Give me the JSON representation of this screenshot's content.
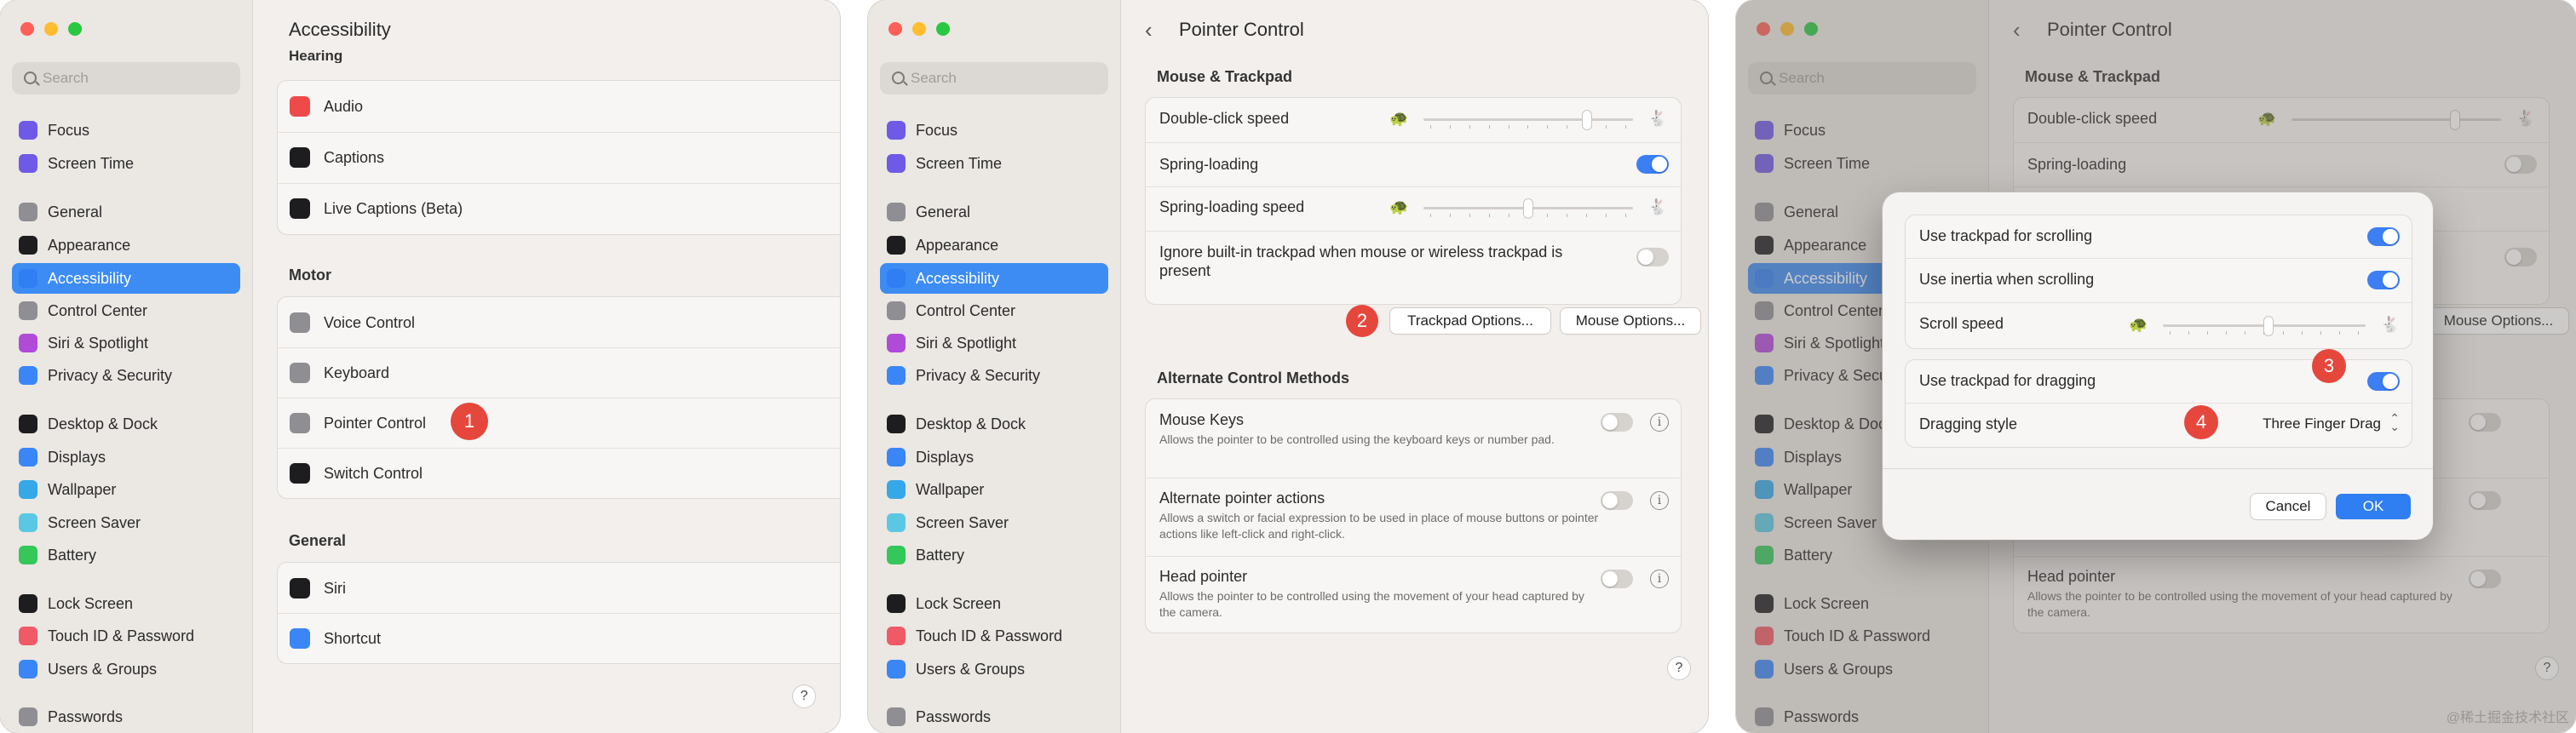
{
  "panels": [
    {
      "sidebar": {
        "search_placeholder": "Search",
        "items": [
          {
            "label": "Focus",
            "icon": "moon-icon",
            "color": "#6e5ae6"
          },
          {
            "label": "Screen Time",
            "icon": "hourglass-icon",
            "color": "#6e5ae6"
          },
          {
            "label": "General",
            "icon": "gear-icon",
            "color": "#8e8e93"
          },
          {
            "label": "Appearance",
            "icon": "appearance-icon",
            "color": "#1d1d1f"
          },
          {
            "label": "Accessibility",
            "icon": "accessibility-icon",
            "color": "#2f7ef2",
            "active": true
          },
          {
            "label": "Control Center",
            "icon": "control-center-icon",
            "color": "#8e8e93"
          },
          {
            "label": "Siri & Spotlight",
            "icon": "siri-icon",
            "color": "#b04ad9"
          },
          {
            "label": "Privacy & Security",
            "icon": "hand-icon",
            "color": "#3a86f6"
          },
          {
            "label": "Desktop & Dock",
            "icon": "dock-icon",
            "color": "#1d1d1f"
          },
          {
            "label": "Displays",
            "icon": "display-icon",
            "color": "#3a86f6"
          },
          {
            "label": "Wallpaper",
            "icon": "wallpaper-icon",
            "color": "#35a8e8"
          },
          {
            "label": "Screen Saver",
            "icon": "screensaver-icon",
            "color": "#5ac8e4"
          },
          {
            "label": "Battery",
            "icon": "battery-icon",
            "color": "#34c759"
          },
          {
            "label": "Lock Screen",
            "icon": "lock-icon",
            "color": "#1d1d1f"
          },
          {
            "label": "Touch ID & Password",
            "icon": "fingerprint-icon",
            "color": "#ef5a66"
          },
          {
            "label": "Users & Groups",
            "icon": "users-icon",
            "color": "#3a86f6"
          },
          {
            "label": "Passwords",
            "icon": "key-icon",
            "color": "#8e8e93"
          }
        ]
      },
      "title": "Accessibility",
      "partial_heading": "Hearing",
      "hearing_items": [
        {
          "label": "Audio",
          "icon": "speaker-icon",
          "color": "#ef4a4a"
        },
        {
          "label": "Captions",
          "icon": "captions-icon",
          "color": "#1d1d1f"
        },
        {
          "label": "Live Captions (Beta)",
          "icon": "live-captions-icon",
          "color": "#1d1d1f"
        }
      ],
      "motor_heading": "Motor",
      "motor_items": [
        {
          "label": "Voice Control",
          "icon": "voice-control-icon",
          "color": "#8e8e93"
        },
        {
          "label": "Keyboard",
          "icon": "keyboard-icon",
          "color": "#8e8e93"
        },
        {
          "label": "Pointer Control",
          "icon": "pointer-icon",
          "color": "#8e8e93"
        },
        {
          "label": "Switch Control",
          "icon": "switch-control-icon",
          "color": "#1d1d1f"
        }
      ],
      "general_heading": "General",
      "general_items": [
        {
          "label": "Siri",
          "icon": "siri-icon",
          "color": "#1d1d1f"
        },
        {
          "label": "Shortcut",
          "icon": "shortcut-icon",
          "color": "#3a86f6"
        }
      ],
      "badge": "1",
      "help": "?"
    },
    {
      "title": "Pointer Control",
      "mouse_heading": "Mouse & Trackpad",
      "double_click": "Double-click speed",
      "double_click_level": 0.78,
      "spring_loading": "Spring-loading",
      "spring_loading_on": true,
      "spring_speed": "Spring-loading speed",
      "spring_speed_level": 0.5,
      "ignore": "Ignore built-in trackpad when mouse or wireless trackpad is present",
      "ignore_on": false,
      "trackpad_options": "Trackpad Options...",
      "mouse_options": "Mouse Options...",
      "badge": "2",
      "alt_heading": "Alternate Control Methods",
      "mouse_keys": "Mouse Keys",
      "mouse_keys_desc": "Allows the pointer to be controlled using the keyboard keys or number pad.",
      "alt_pointer": "Alternate pointer actions",
      "alt_pointer_desc": "Allows a switch or facial expression to be used in place of mouse buttons or pointer actions like left-click and right-click.",
      "head_pointer": "Head pointer",
      "head_pointer_desc": "Allows the pointer to be controlled using the movement of your head captured by the camera.",
      "help": "?"
    },
    {
      "sheet": {
        "use_scrolling": "Use trackpad for scrolling",
        "use_inertia": "Use inertia when scrolling",
        "scroll_speed": "Scroll speed",
        "scroll_speed_level": 0.52,
        "use_dragging": "Use trackpad for dragging",
        "dragging_style_label": "Dragging style",
        "dragging_style_value": "Three Finger Drag",
        "cancel": "Cancel",
        "ok": "OK",
        "badge3": "3",
        "badge4": "4"
      },
      "watermark": "@稀土掘金技术社区"
    }
  ]
}
